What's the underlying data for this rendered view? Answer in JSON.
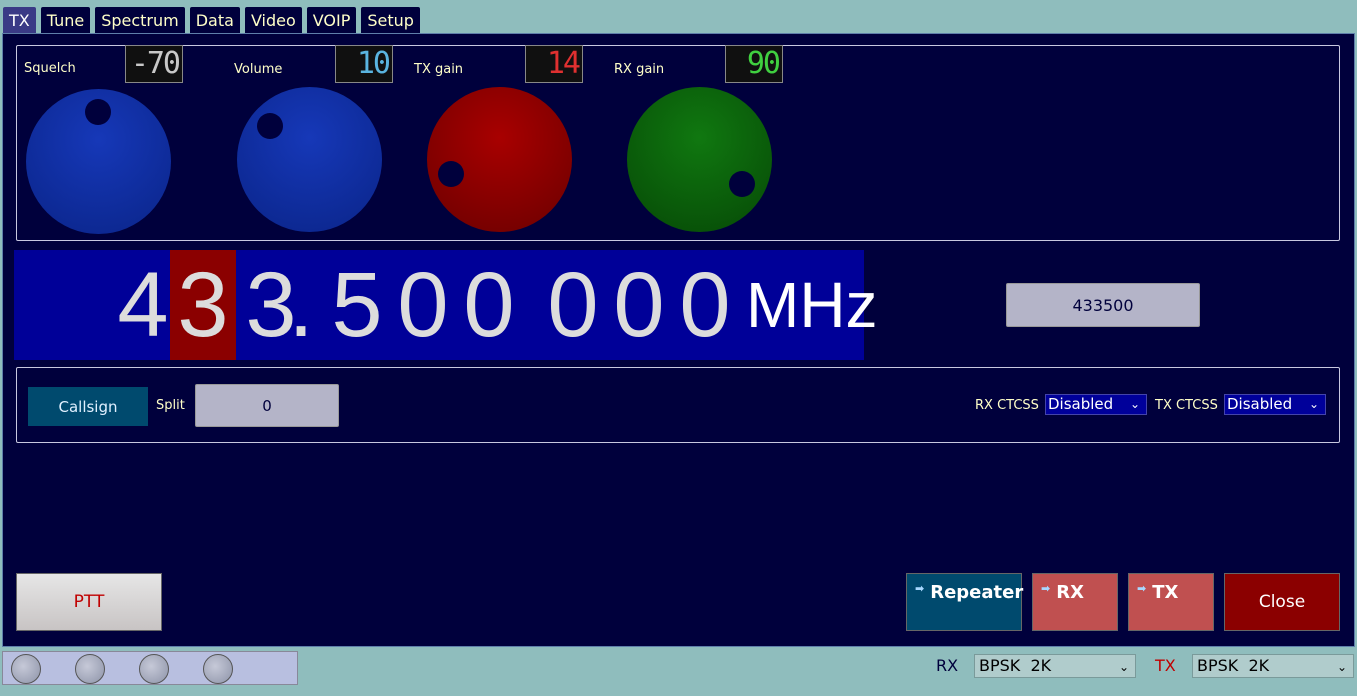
{
  "tabs": [
    {
      "label": "TX",
      "active": true
    },
    {
      "label": "Tune"
    },
    {
      "label": "Spectrum"
    },
    {
      "label": "Data"
    },
    {
      "label": "Video"
    },
    {
      "label": "VOIP"
    },
    {
      "label": "Setup"
    }
  ],
  "knobs": {
    "squelch": {
      "label": "Squelch",
      "value": "-70",
      "lcd_color": "#c8c8c8",
      "knob_color": "#0a2aa0"
    },
    "volume": {
      "label": "Volume",
      "value": "10",
      "lcd_color": "#5ab4e0",
      "knob_color": "#0a2aa0"
    },
    "tx_gain": {
      "label": "TX gain",
      "value": "14",
      "lcd_color": "#e03030",
      "knob_color": "#8b0000"
    },
    "rx_gain": {
      "label": "RX gain",
      "value": "90",
      "lcd_color": "#40d040",
      "knob_color": "#0a5a0a"
    }
  },
  "frequency": {
    "digits": [
      "4",
      "3",
      "3",
      ".",
      "5",
      "0",
      "0",
      "0",
      "0",
      "0"
    ],
    "unit": "MHz",
    "selected_digit_index": 1
  },
  "freq_entry": {
    "value": "433500"
  },
  "controls": {
    "callsign_label": "Callsign",
    "split_label": "Split",
    "split_value": "0",
    "rx_ctcss_label": "RX CTCSS",
    "rx_ctcss_value": "Disabled",
    "tx_ctcss_label": "TX CTCSS",
    "tx_ctcss_value": "Disabled"
  },
  "buttons": {
    "ptt": "PTT",
    "repeater": "Repeater",
    "rx": "RX",
    "tx": "TX",
    "close": "Close"
  },
  "status": {
    "rx_label": "RX",
    "rx_mode": "BPSK  2K",
    "tx_label": "TX",
    "tx_mode": "BPSK  2K"
  },
  "colors": {
    "panel_bg": "#00003c",
    "accent_teal": "#004a6e",
    "rx_tx_btn": "#c05050",
    "close_btn": "#8b0000"
  }
}
